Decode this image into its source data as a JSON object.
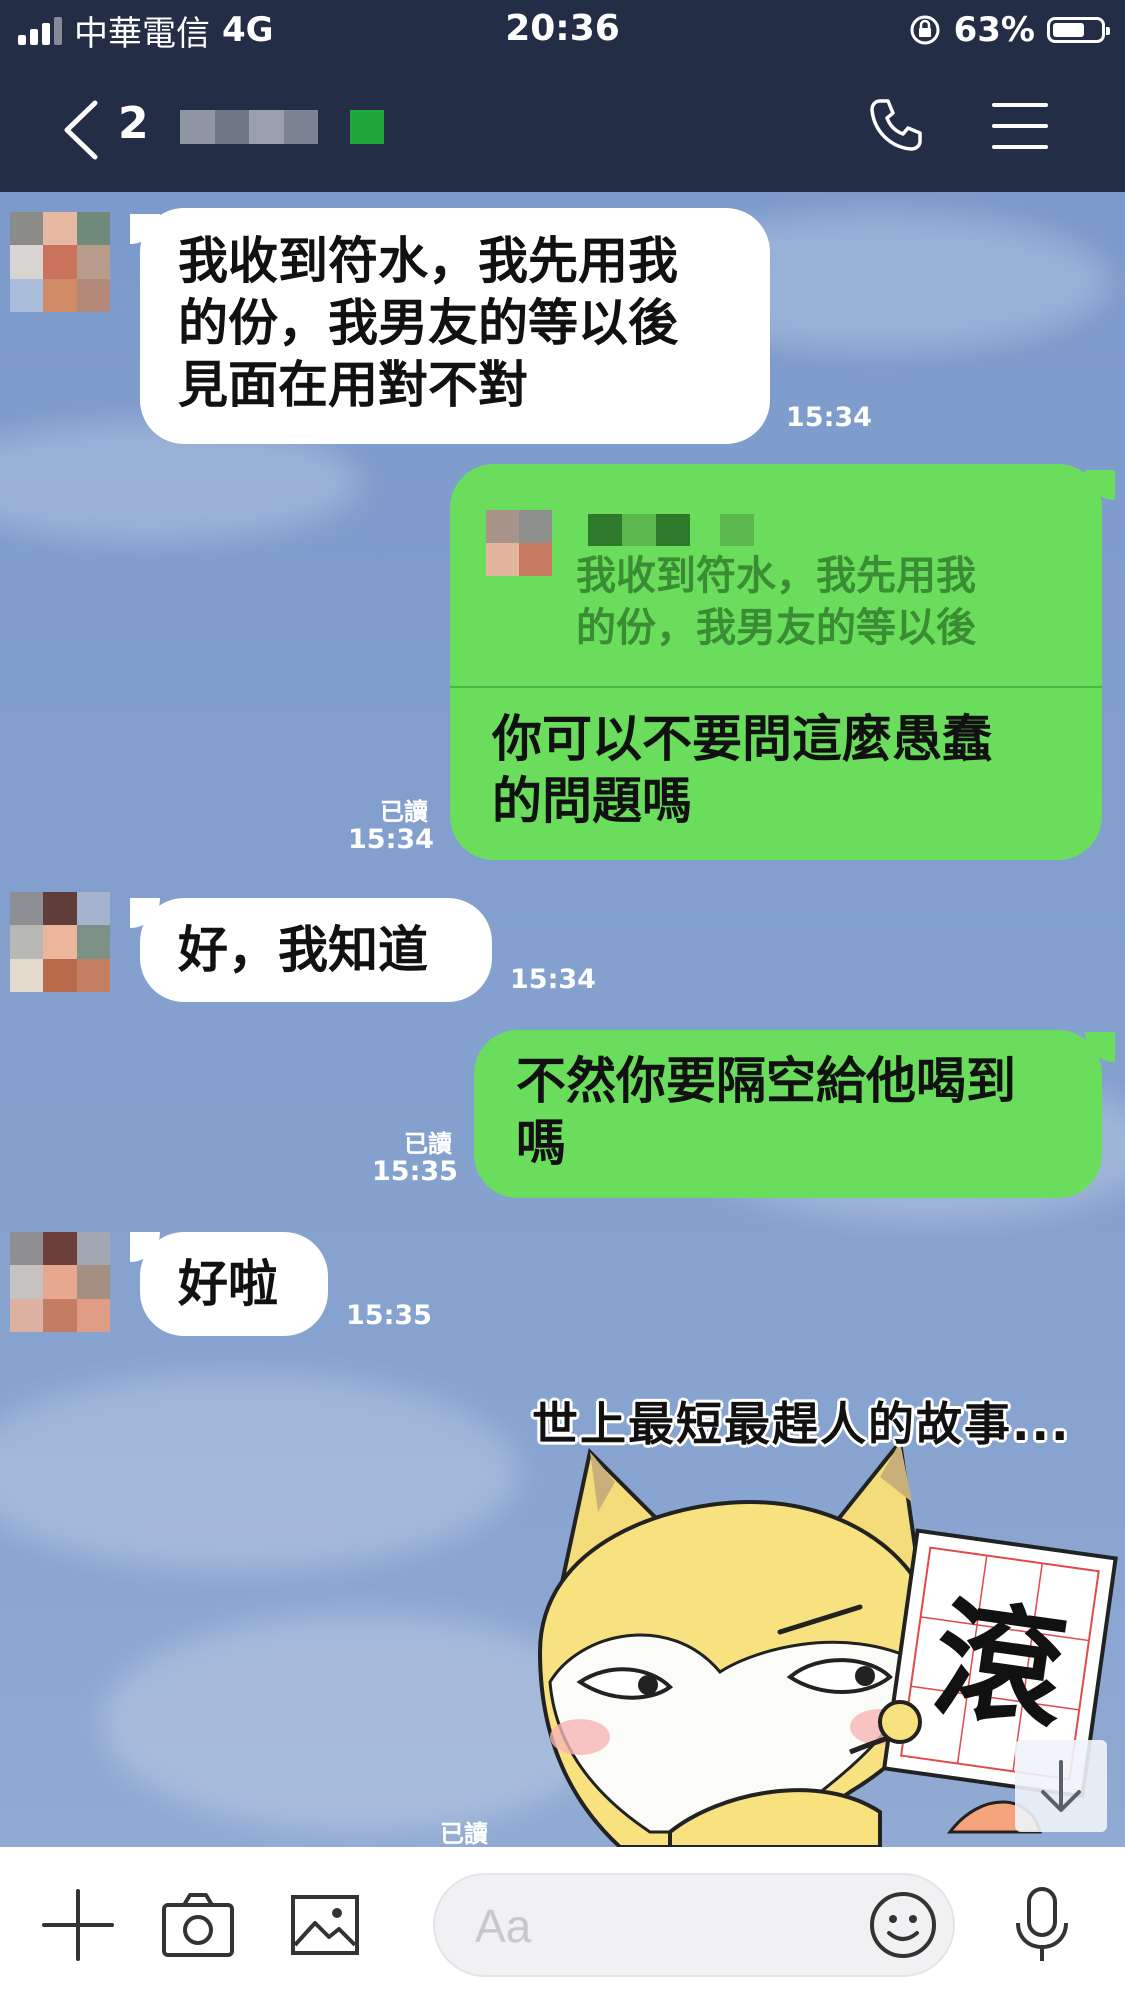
{
  "status_bar": {
    "carrier": "中華電信",
    "network": "4G",
    "time": "20:36",
    "battery": "63%"
  },
  "header": {
    "member_count": "2"
  },
  "messages": [
    {
      "text_lines": [
        "我收到符水，我先用我",
        "的份，我男友的等以後",
        "見面在用對不對"
      ],
      "time": "15:34"
    },
    {
      "quote_lines": [
        "我收到符水，我先用我",
        "的份，我男友的等以後"
      ],
      "text_lines": [
        "你可以不要問這麼愚蠢",
        "的問題嗎"
      ],
      "read": "已讀",
      "time": "15:34"
    },
    {
      "text_lines": [
        "好，我知道"
      ],
      "time": "15:34"
    },
    {
      "text_lines": [
        "不然你要隔空給他喝到",
        "嗎"
      ],
      "read": "已讀",
      "time": "15:35"
    },
    {
      "text_lines": [
        "好啦"
      ],
      "time": "15:35"
    },
    {
      "sticker_caption": "世上最短最趕人的故事...",
      "sticker_sign": "滾",
      "read": "已讀"
    }
  ],
  "input": {
    "placeholder": "Aa"
  },
  "icons": {
    "back": "chevron-left-icon",
    "call": "phone-icon",
    "menu": "hamburger-icon",
    "add": "plus-icon",
    "camera": "camera-icon",
    "gallery": "image-icon",
    "emoji": "smiley-icon",
    "mic": "microphone-icon",
    "scroll": "arrow-down-icon"
  },
  "colors": {
    "header": "#232d45",
    "chat_bg": "#7d9ccb",
    "outgoing_bubble": "#6ade5c",
    "incoming_bubble": "#ffffff"
  }
}
